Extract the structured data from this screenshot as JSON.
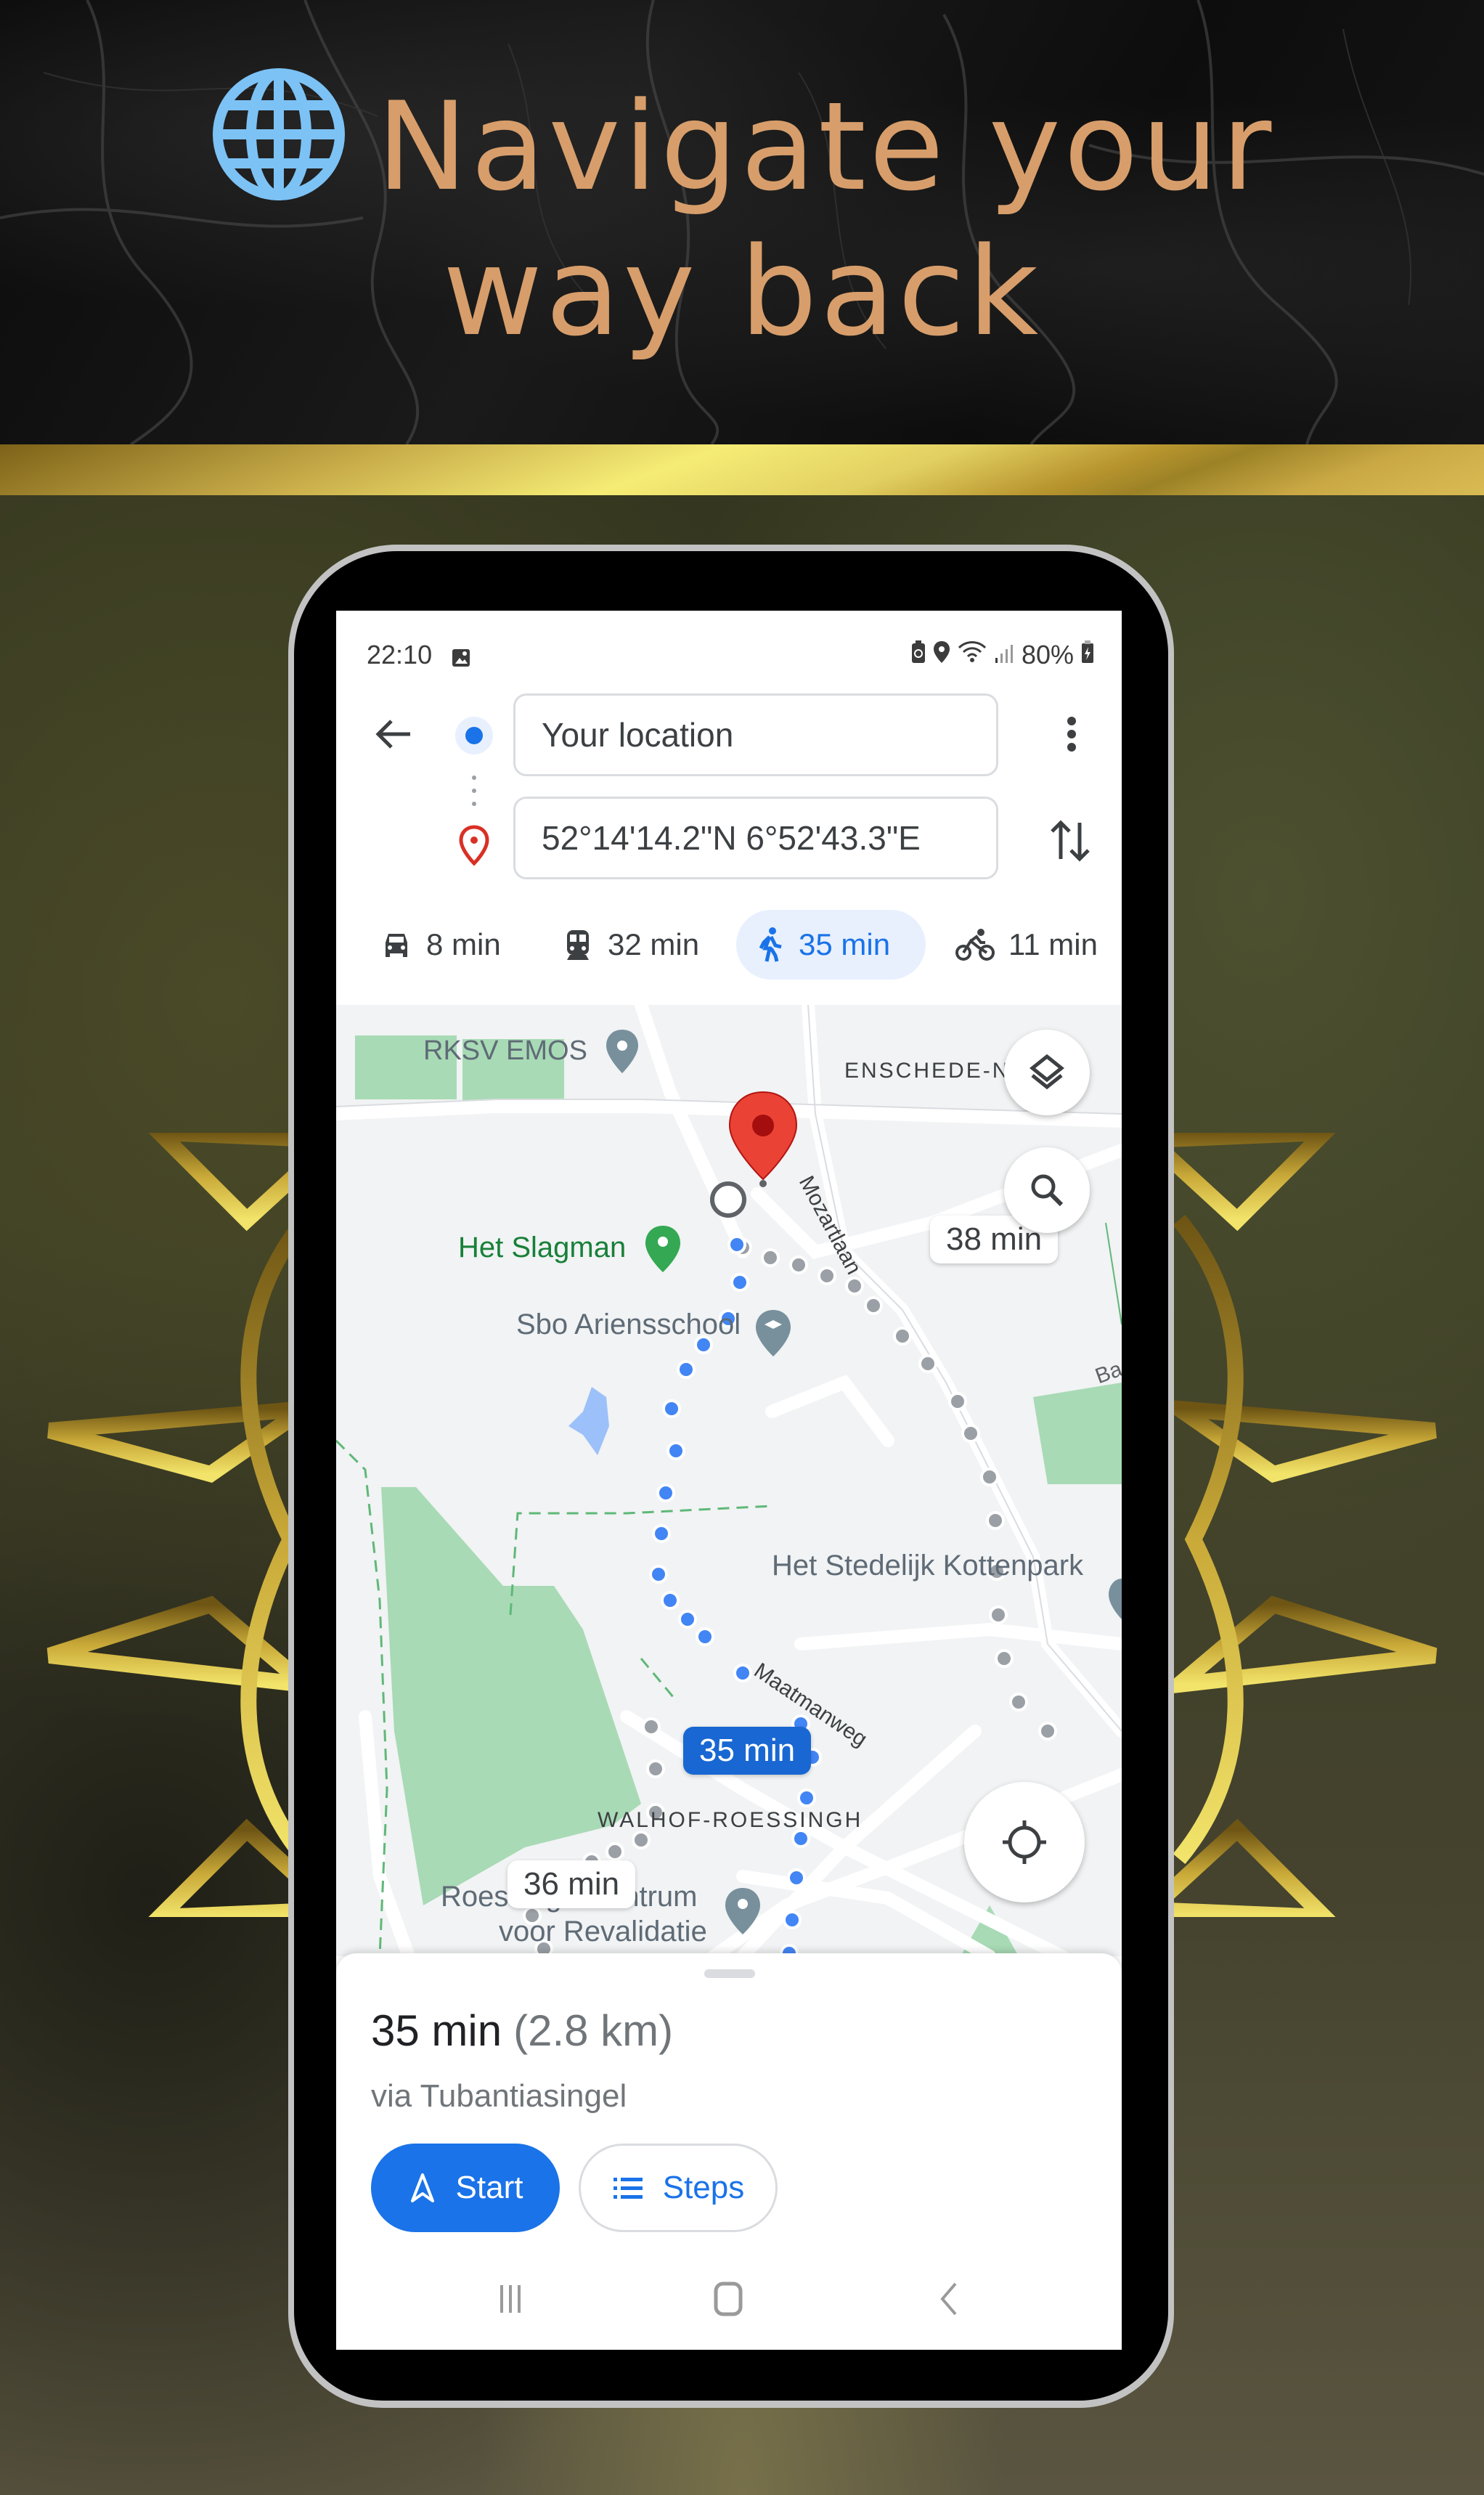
{
  "promo": {
    "headline_line1": "Navigate your",
    "headline_line2": "way back",
    "globe_icon": "globe-icon",
    "colors": {
      "headline": "#d79e6b",
      "globe": "#7cc2f5",
      "gold": "#f5ec75"
    }
  },
  "statusbar": {
    "time": "22:10",
    "battery": "80%",
    "icons": [
      "image-icon",
      "battery-saver-icon",
      "location-icon",
      "wifi-icon",
      "signal-icon",
      "battery-charging-icon"
    ]
  },
  "directions": {
    "origin": "Your location",
    "destination": "52°14'14.2\"N 6°52'43.3\"E",
    "modes": [
      {
        "id": "drive",
        "icon": "car-icon",
        "label": "8 min",
        "active": false
      },
      {
        "id": "transit",
        "icon": "train-icon",
        "label": "32 min",
        "active": false
      },
      {
        "id": "walk",
        "icon": "walk-icon",
        "label": "35 min",
        "active": true
      },
      {
        "id": "bike",
        "icon": "bike-icon",
        "label": "11 min",
        "active": false
      }
    ]
  },
  "map": {
    "labels": {
      "rksv": "RKSV EMOS",
      "enschede": "ENSCHEDE-NO",
      "mozartlaan": "Mozartlaan",
      "slagman": "Het Slagman",
      "sbo": "Sbo Ariensschool",
      "kottenpark": "Het Stedelijk Kottenpark",
      "ba": "Ba",
      "maatmanweg": "Maatmanweg",
      "walhof": "WALHOF-ROESSINGH",
      "roes_line1": "Roessingh Centrum",
      "roes_line2": "voor Revalidatie"
    },
    "route_bubbles": {
      "alt1": "38 min",
      "selected": "35 min",
      "alt2": "36 min"
    },
    "colors": {
      "route": "#4285f4",
      "alt_route": "#9aa0a6",
      "park": "#a8dab5",
      "water": "#9cc0f9",
      "pin": "#ea4335"
    }
  },
  "sheet": {
    "duration": "35 min",
    "distance": "(2.8 km)",
    "via": "via Tubantiasingel",
    "start_label": "Start",
    "steps_label": "Steps"
  }
}
